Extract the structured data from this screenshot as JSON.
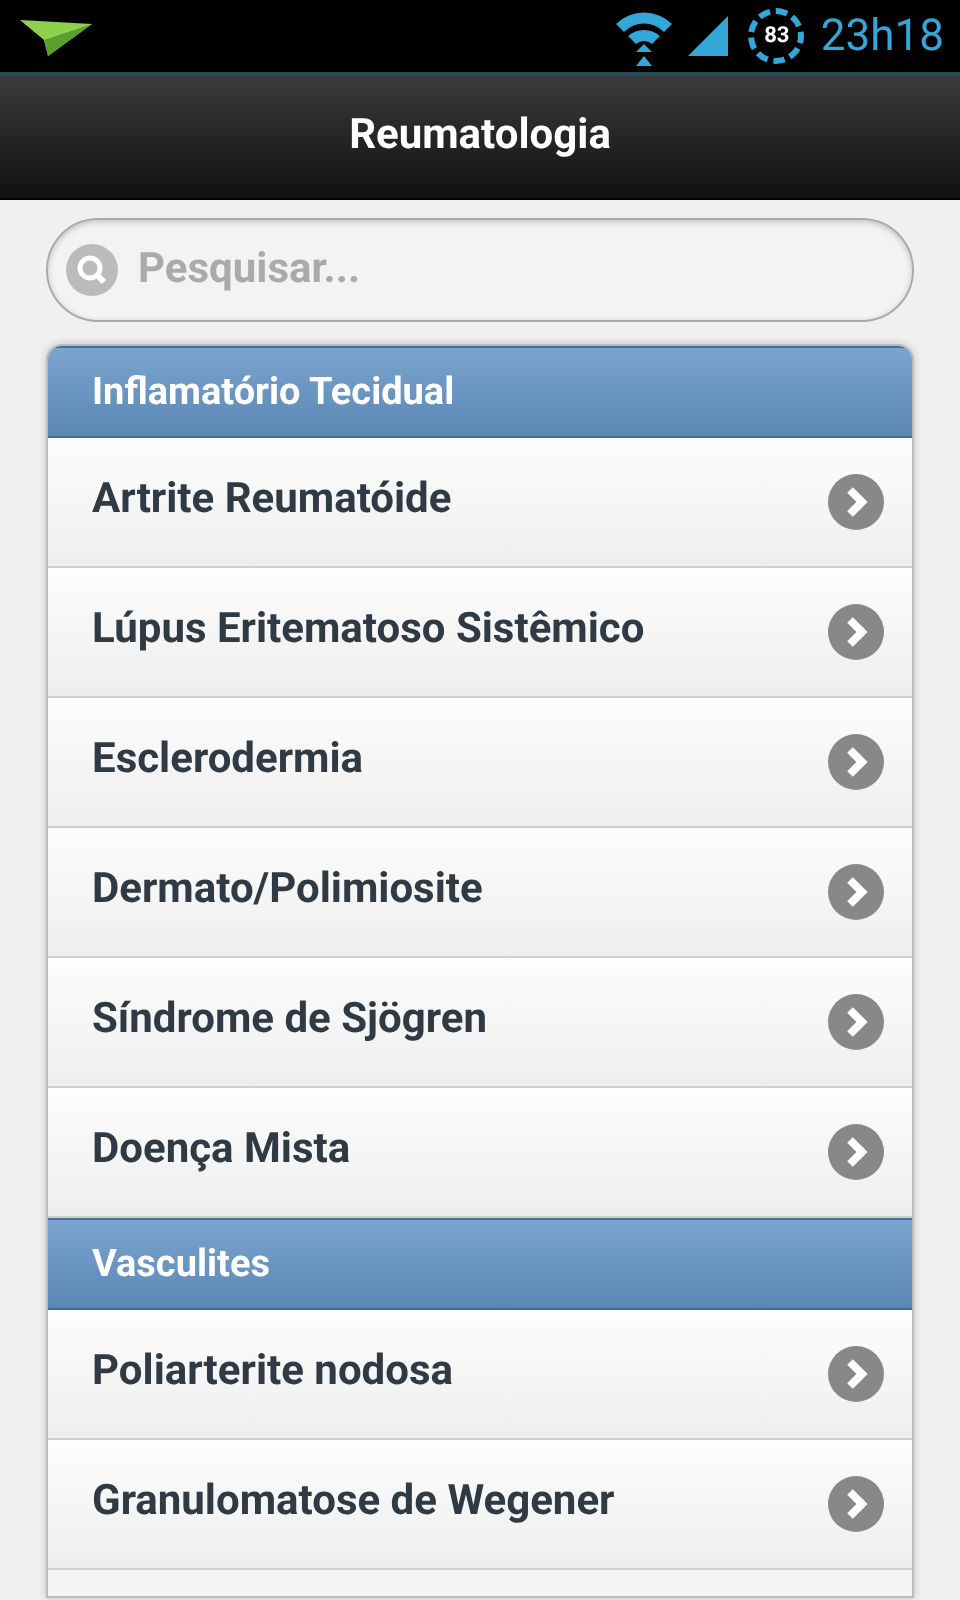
{
  "status_bar": {
    "battery": "83",
    "time": "23h18"
  },
  "header": {
    "title": "Reumatologia"
  },
  "search": {
    "placeholder": "Pesquisar..."
  },
  "sections": [
    {
      "title": "Inflamatório Tecidual",
      "items": [
        {
          "label": "Artrite Reumatóide"
        },
        {
          "label": "Lúpus Eritematoso Sistêmico"
        },
        {
          "label": "Esclerodermia"
        },
        {
          "label": "Dermato/Polimiosite"
        },
        {
          "label": "Síndrome de Sjögren"
        },
        {
          "label": "Doença Mista"
        }
      ]
    },
    {
      "title": "Vasculites",
      "items": [
        {
          "label": "Poliarterite nodosa"
        },
        {
          "label": "Granulomatose de Wegener"
        }
      ]
    }
  ]
}
